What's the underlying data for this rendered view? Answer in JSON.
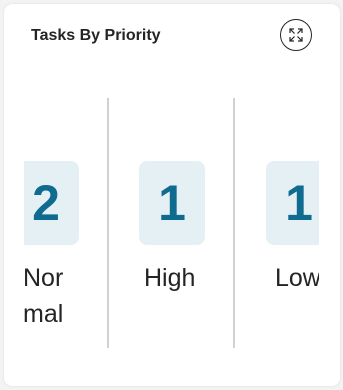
{
  "card": {
    "title": "Tasks By Priority",
    "expand_icon": "expand-arrows-icon"
  },
  "priorities": [
    {
      "count": "2",
      "label_line1": "Nor",
      "label_line2": "mal"
    },
    {
      "count": "1",
      "label": "High"
    },
    {
      "count": "1",
      "label": "Low"
    }
  ],
  "colors": {
    "tile_bg": "#e5f0f5",
    "count_text": "#0f6b8f",
    "divider": "#d1d1d1"
  }
}
